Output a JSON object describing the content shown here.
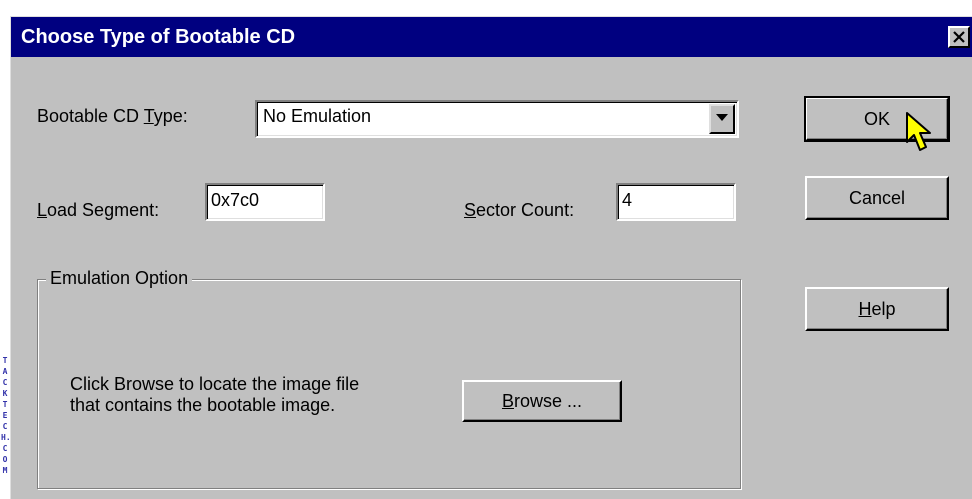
{
  "dialog": {
    "title": "Choose Type of Bootable CD",
    "close_glyph": "×"
  },
  "fields": {
    "cd_type_label_pre": "Bootable CD ",
    "cd_type_label_key": "T",
    "cd_type_label_post": "ype:",
    "cd_type_value": "No Emulation",
    "load_segment_label_key": "L",
    "load_segment_label_post": "oad Segment:",
    "load_segment_value": "0x7c0",
    "sector_count_label_key": "S",
    "sector_count_label_post": "ector Count:",
    "sector_count_value": "4"
  },
  "emulation": {
    "legend": "Emulation Option",
    "instructions_line1": "Click Browse to locate the image file",
    "instructions_line2": "that contains the bootable image.",
    "browse_key": "B",
    "browse_post": "rowse ..."
  },
  "buttons": {
    "ok": "OK",
    "cancel": "Cancel",
    "help_key": "H",
    "help_post": "elp"
  },
  "watermark": {
    "text": "TACKTECH.COM"
  },
  "icons": {
    "close": "close-icon",
    "dropdown": "chevron-down-icon",
    "cursor": "arrow-cursor-icon"
  },
  "colors": {
    "titlebar": "#000080",
    "face": "#c0c0c0",
    "cursor": "#ffff00"
  }
}
